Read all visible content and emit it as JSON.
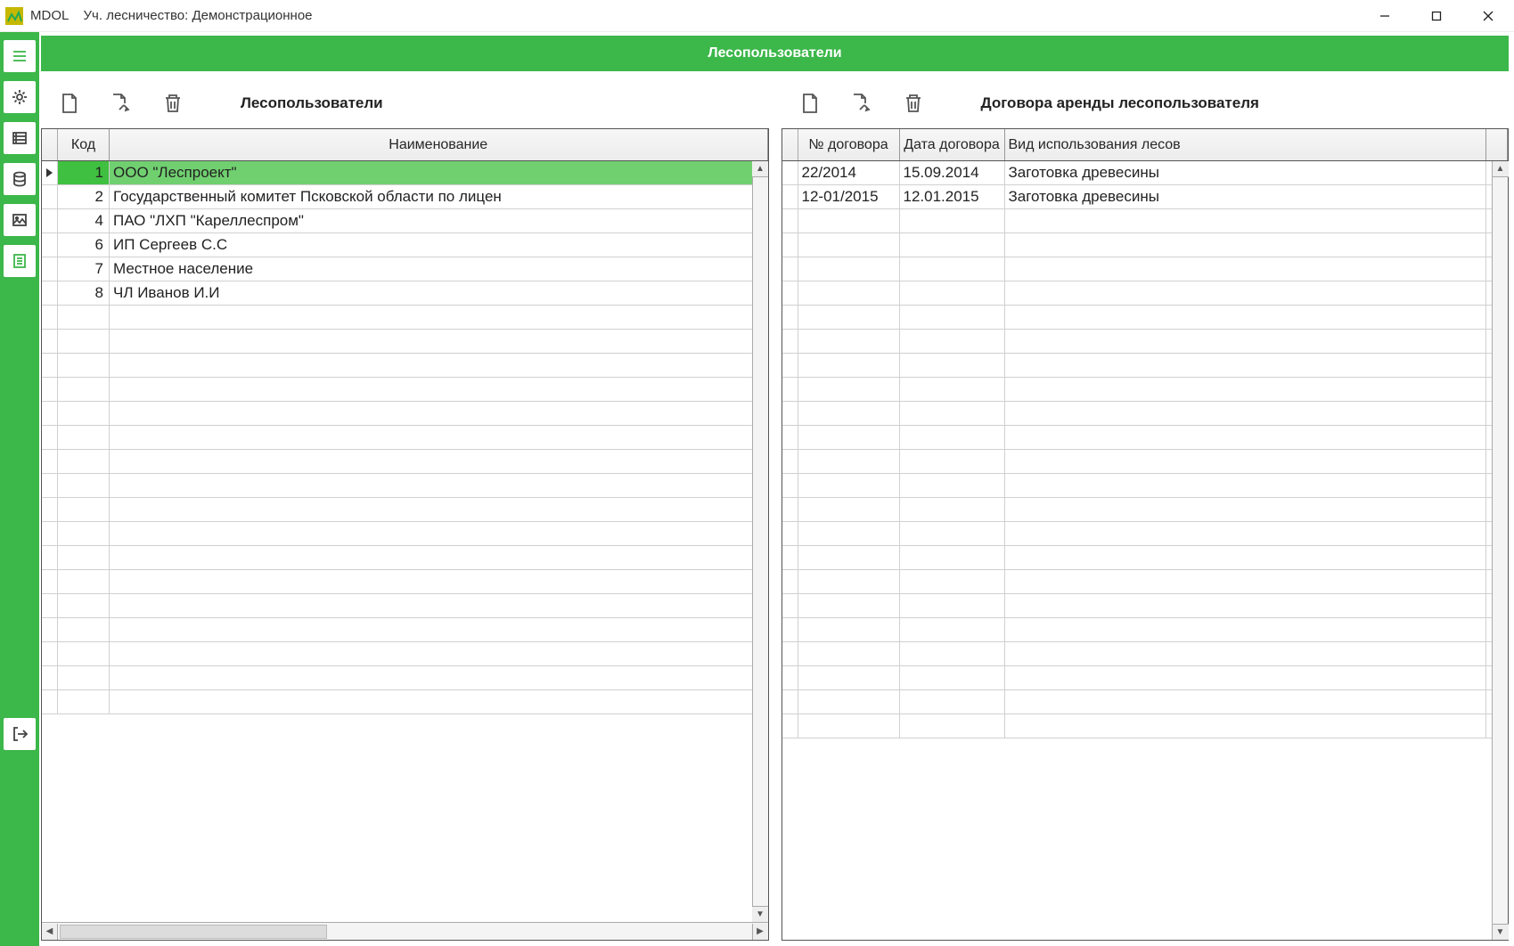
{
  "titlebar": {
    "app": "MDOL",
    "subtitle": "Уч. лесничество: Демонстрационное"
  },
  "header": {
    "title": "Лесопользователи"
  },
  "leftPanel": {
    "title": "Лесопользователи",
    "columns": {
      "code": "Код",
      "name": "Наименование"
    },
    "rows": [
      {
        "code": "1",
        "name": "ООО \"Леспроект\"",
        "selected": true
      },
      {
        "code": "2",
        "name": "Государственный комитет Псковской области по лицен"
      },
      {
        "code": "4",
        "name": "ПАО \"ЛХП \"Кареллеспром\""
      },
      {
        "code": "6",
        "name": "ИП Сергеев С.С"
      },
      {
        "code": "7",
        "name": "Местное население"
      },
      {
        "code": "8",
        "name": "ЧЛ Иванов И.И"
      }
    ]
  },
  "rightPanel": {
    "title": "Договора аренды лесопользователя",
    "columns": {
      "c1": "№ договора",
      "c2": "Дата договора",
      "c3": "Вид использования лесов"
    },
    "rows": [
      {
        "c1": "22/2014",
        "c2": "15.09.2014",
        "c3": "Заготовка древесины"
      },
      {
        "c1": "12-01/2015",
        "c2": "12.01.2015",
        "c3": "Заготовка древесины"
      }
    ]
  }
}
